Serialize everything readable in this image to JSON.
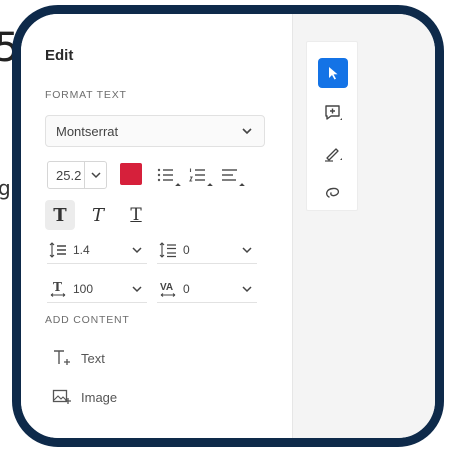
{
  "background": {
    "peek_digit": "5",
    "peek_letter": "g"
  },
  "panel": {
    "title": "Edit",
    "format_section": "FORMAT TEXT",
    "font_family": "Montserrat",
    "font_size": "25.2",
    "text_color": "#d6203b",
    "styles": {
      "bold": "T",
      "italic": "T",
      "underline": "T"
    },
    "line_height": "1.4",
    "paragraph_spacing": "0",
    "char_scale": "100",
    "tracking": "0",
    "add_section": "ADD CONTENT",
    "add_text_label": "Text",
    "add_image_label": "Image"
  },
  "toolbar": {
    "tools": [
      "select-icon",
      "add-comment-icon",
      "draw-icon",
      "lasso-icon"
    ],
    "accent": "#1473e6"
  },
  "colors": {
    "frame": "#0e2a4a"
  }
}
